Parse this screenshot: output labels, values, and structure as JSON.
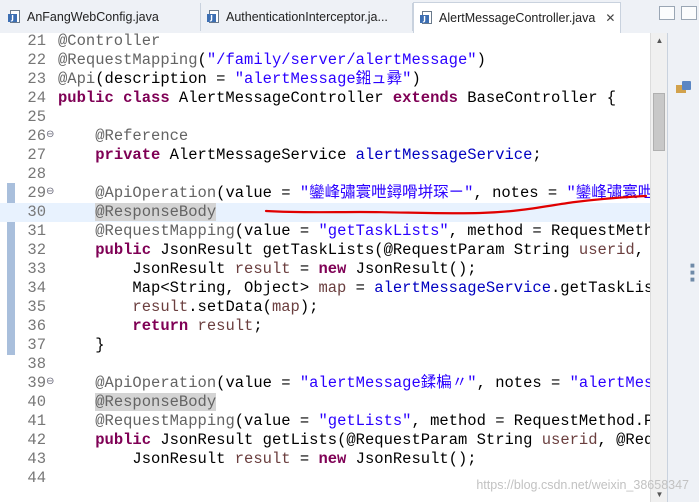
{
  "tabs": [
    {
      "label": "AnFangWebConfig.java",
      "active": false
    },
    {
      "label": "AuthenticationInterceptor.ja...",
      "active": false
    },
    {
      "label": "AlertMessageController.java",
      "active": true,
      "close": "✕"
    }
  ],
  "editor": {
    "lines": [
      {
        "n": "21",
        "fold": false,
        "parts": [
          [
            "ann",
            "@Controller"
          ]
        ]
      },
      {
        "n": "22",
        "fold": false,
        "parts": [
          [
            "ann",
            "@RequestMapping"
          ],
          [
            "txt",
            "("
          ],
          [
            "str",
            "\"/family/server/alertMessage\""
          ],
          [
            "txt",
            ")"
          ]
        ]
      },
      {
        "n": "23",
        "fold": false,
        "parts": [
          [
            "ann",
            "@Api"
          ],
          [
            "txt",
            "(description = "
          ],
          [
            "str",
            "\"alertMessage鎺ュ彛\""
          ],
          [
            "txt",
            ")"
          ]
        ]
      },
      {
        "n": "24",
        "fold": false,
        "parts": [
          [
            "kw",
            "public class "
          ],
          [
            "txt",
            "AlertMessageController "
          ],
          [
            "kw",
            "extends "
          ],
          [
            "txt",
            "BaseController {"
          ]
        ]
      },
      {
        "n": "25",
        "fold": false,
        "parts": []
      },
      {
        "n": "26",
        "fold": true,
        "parts": [
          [
            "txt",
            "    "
          ],
          [
            "ann",
            "@Reference"
          ]
        ]
      },
      {
        "n": "27",
        "fold": false,
        "parts": [
          [
            "txt",
            "    "
          ],
          [
            "kw",
            "private "
          ],
          [
            "txt",
            "AlertMessageService "
          ],
          [
            "fld",
            "alertMessageService"
          ],
          [
            "txt",
            ";"
          ]
        ]
      },
      {
        "n": "28",
        "fold": false,
        "parts": []
      },
      {
        "n": "29",
        "fold": true,
        "parts": [
          [
            "txt",
            "    "
          ],
          [
            "ann",
            "@ApiOperation"
          ],
          [
            "txt",
            "(value = "
          ],
          [
            "str",
            "\"鑾峰彇寰呭鐞嗗垪琛ㄧ\""
          ],
          [
            "txt",
            ", notes = "
          ],
          [
            "str",
            "\"鑾峰彇寰呭鐞嗗"
          ]
        ]
      },
      {
        "n": "30",
        "fold": false,
        "highlight": true,
        "parts": [
          [
            "txt",
            "    "
          ],
          [
            "annhl",
            "@ResponseBody"
          ]
        ]
      },
      {
        "n": "31",
        "fold": false,
        "parts": [
          [
            "txt",
            "    "
          ],
          [
            "ann",
            "@RequestMapping"
          ],
          [
            "txt",
            "(value = "
          ],
          [
            "str",
            "\"getTaskLists\""
          ],
          [
            "txt",
            ", method = RequestMethod"
          ]
        ]
      },
      {
        "n": "32",
        "fold": false,
        "parts": [
          [
            "txt",
            "    "
          ],
          [
            "kw",
            "public "
          ],
          [
            "txt",
            "JsonResult getTaskLists(@RequestParam String "
          ],
          [
            "loc",
            "userid"
          ],
          [
            "txt",
            ", @R"
          ]
        ]
      },
      {
        "n": "33",
        "fold": false,
        "parts": [
          [
            "txt",
            "        JsonResult "
          ],
          [
            "loc",
            "result"
          ],
          [
            "txt",
            " = "
          ],
          [
            "kw",
            "new "
          ],
          [
            "txt",
            "JsonResult();"
          ]
        ]
      },
      {
        "n": "34",
        "fold": false,
        "parts": [
          [
            "txt",
            "        Map<String, Object> "
          ],
          [
            "loc",
            "map"
          ],
          [
            "txt",
            " = "
          ],
          [
            "fld",
            "alertMessageService"
          ],
          [
            "txt",
            ".getTaskLists"
          ]
        ]
      },
      {
        "n": "35",
        "fold": false,
        "parts": [
          [
            "txt",
            "        "
          ],
          [
            "loc",
            "result"
          ],
          [
            "txt",
            ".setData("
          ],
          [
            "loc",
            "map"
          ],
          [
            "txt",
            ");"
          ]
        ]
      },
      {
        "n": "36",
        "fold": false,
        "parts": [
          [
            "txt",
            "        "
          ],
          [
            "kw",
            "return "
          ],
          [
            "loc",
            "result"
          ],
          [
            "txt",
            ";"
          ]
        ]
      },
      {
        "n": "37",
        "fold": false,
        "parts": [
          [
            "txt",
            "    }"
          ]
        ]
      },
      {
        "n": "38",
        "fold": false,
        "parts": []
      },
      {
        "n": "39",
        "fold": true,
        "parts": [
          [
            "txt",
            "    "
          ],
          [
            "ann",
            "@ApiOperation"
          ],
          [
            "txt",
            "(value = "
          ],
          [
            "str",
            "\"alertMessage鍒楄〃\""
          ],
          [
            "txt",
            ", notes = "
          ],
          [
            "str",
            "\"alertMessag"
          ]
        ]
      },
      {
        "n": "40",
        "fold": false,
        "parts": [
          [
            "txt",
            "    "
          ],
          [
            "annhl",
            "@ResponseBody"
          ]
        ]
      },
      {
        "n": "41",
        "fold": false,
        "parts": [
          [
            "txt",
            "    "
          ],
          [
            "ann",
            "@RequestMapping"
          ],
          [
            "txt",
            "(value = "
          ],
          [
            "str",
            "\"getLists\""
          ],
          [
            "txt",
            ", method = RequestMethod.POS"
          ]
        ]
      },
      {
        "n": "42",
        "fold": false,
        "parts": [
          [
            "txt",
            "    "
          ],
          [
            "kw",
            "public "
          ],
          [
            "txt",
            "JsonResult getLists(@RequestParam String "
          ],
          [
            "loc",
            "userid"
          ],
          [
            "txt",
            ", @Reque"
          ]
        ]
      },
      {
        "n": "43",
        "fold": false,
        "parts": [
          [
            "txt",
            "        JsonResult "
          ],
          [
            "loc",
            "result"
          ],
          [
            "txt",
            " = "
          ],
          [
            "kw",
            "new "
          ],
          [
            "txt",
            "JsonResult();"
          ]
        ]
      },
      {
        "n": "44",
        "fold": false,
        "parts": []
      }
    ]
  },
  "watermark": "https://blog.csdn.net/weixin_38658347",
  "colors": {
    "keyword": "#7f0055",
    "string": "#2a00ff",
    "annotation": "#646464",
    "field": "#0000c0",
    "local": "#6a3e3e",
    "markup": "#e00000"
  }
}
